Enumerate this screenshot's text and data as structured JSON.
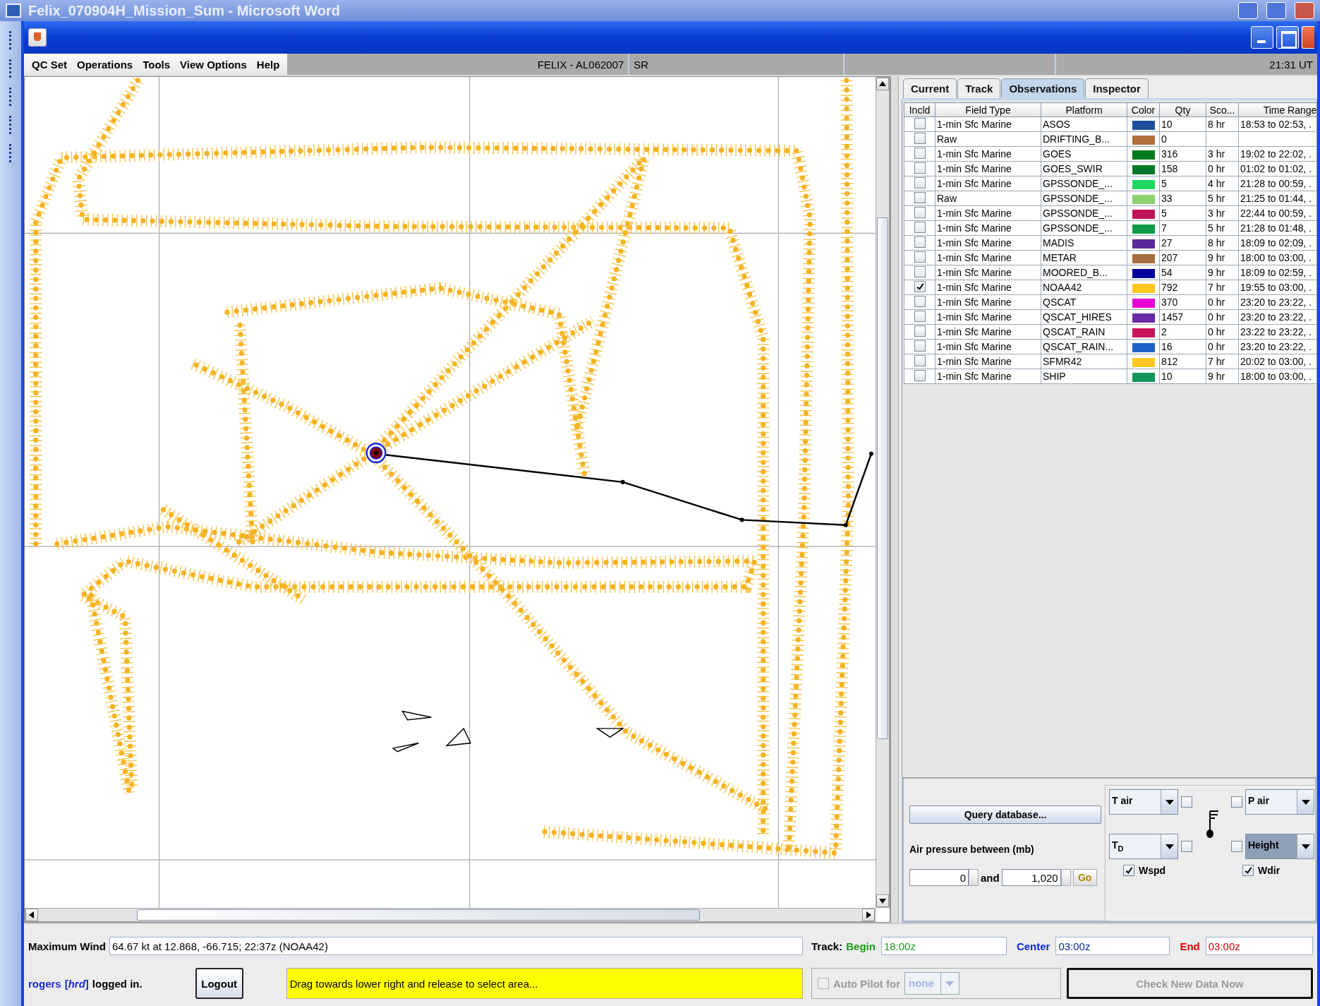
{
  "background_window": {
    "title": "Felix_070904H_Mission_Sum - Microsoft Word"
  },
  "window": {
    "menu": [
      "QC Set",
      "Operations",
      "Tools",
      "View Options",
      "Help"
    ],
    "storm": "FELIX - AL062007",
    "mode": "SR",
    "clock": "21:31 UT"
  },
  "tabs": [
    {
      "label": "Current",
      "selected": false
    },
    {
      "label": "Track",
      "selected": false
    },
    {
      "label": "Observations",
      "selected": true
    },
    {
      "label": "Inspector",
      "selected": false
    }
  ],
  "table": {
    "columns": [
      "Incld",
      "Field Type",
      "Platform",
      "Color",
      "Qty",
      "Sco...",
      "Time Range"
    ],
    "rows": [
      {
        "included": false,
        "field_type": "1-min Sfc Marine",
        "platform": "ASOS",
        "color": "#1f4f9a",
        "qty": "10",
        "scope": "8 hr",
        "time_range": "18:53 to 02:53, ."
      },
      {
        "included": false,
        "field_type": "Raw",
        "platform": "DRIFTING_B...",
        "color": "#b06e3a",
        "qty": "0"
      },
      {
        "included": false,
        "field_type": "1-min Sfc Marine",
        "platform": "GOES",
        "color": "#007a1e",
        "qty": "316",
        "scope": "3 hr",
        "time_range": "19:02 to 22:02, ."
      },
      {
        "included": false,
        "field_type": "1-min Sfc Marine",
        "platform": "GOES_SWIR",
        "color": "#007828",
        "qty": "158",
        "scope": "0 hr",
        "time_range": "01:02 to 01:02, ."
      },
      {
        "included": false,
        "field_type": "1-min Sfc Marine",
        "platform": "GPSSONDE_...",
        "color": "#1ed760",
        "qty": "5",
        "scope": "4 hr",
        "time_range": "21:28 to 00:59, ."
      },
      {
        "included": false,
        "field_type": "Raw",
        "platform": "GPSSONDE_...",
        "color": "#8fd070",
        "qty": "33",
        "scope": "5 hr",
        "time_range": "21:25 to 01:44, ."
      },
      {
        "included": false,
        "field_type": "1-min Sfc Marine",
        "platform": "GPSSONDE_...",
        "color": "#c0145a",
        "qty": "5",
        "scope": "3 hr",
        "time_range": "22:44 to 00:59, ."
      },
      {
        "included": false,
        "field_type": "1-min Sfc Marine",
        "platform": "GPSSONDE_...",
        "color": "#0e9a48",
        "qty": "7",
        "scope": "5 hr",
        "time_range": "21:28 to 01:48, ."
      },
      {
        "included": false,
        "field_type": "1-min Sfc Marine",
        "platform": "MADIS",
        "color": "#5b2a96",
        "qty": "27",
        "scope": "8 hr",
        "time_range": "18:09 to 02:09, ."
      },
      {
        "included": false,
        "field_type": "1-min Sfc Marine",
        "platform": "METAR",
        "color": "#a86d3e",
        "qty": "207",
        "scope": "9 hr",
        "time_range": "18:00 to 03:00, ."
      },
      {
        "included": false,
        "field_type": "1-min Sfc Marine",
        "platform": "MOORED_B...",
        "color": "#000099",
        "qty": "54",
        "scope": "9 hr",
        "time_range": "18:09 to 02:59, ."
      },
      {
        "included": true,
        "field_type": "1-min Sfc Marine",
        "platform": "NOAA42",
        "color": "#ffc61e",
        "qty": "792",
        "scope": "7 hr",
        "time_range": "19:55 to 03:00, ."
      },
      {
        "included": false,
        "field_type": "1-min Sfc Marine",
        "platform": "QSCAT",
        "color": "#e600d4",
        "qty": "370",
        "scope": "0 hr",
        "time_range": "23:20 to 23:22, ."
      },
      {
        "included": false,
        "field_type": "1-min Sfc Marine",
        "platform": "QSCAT_HIRES",
        "color": "#6a2aa6",
        "qty": "1457",
        "scope": "0 hr",
        "time_range": "23:20 to 23:22, ."
      },
      {
        "included": false,
        "field_type": "1-min Sfc Marine",
        "platform": "QSCAT_RAIN",
        "color": "#c8145a",
        "qty": "2",
        "scope": "0 hr",
        "time_range": "23:22 to 23:22, ."
      },
      {
        "included": false,
        "field_type": "1-min Sfc Marine",
        "platform": "QSCAT_RAIN...",
        "color": "#1e62c8",
        "qty": "16",
        "scope": "0 hr",
        "time_range": "23:20 to 23:22, ."
      },
      {
        "included": false,
        "field_type": "1-min Sfc Marine",
        "platform": "SFMR42",
        "color": "#ffc820",
        "qty": "812",
        "scope": "7 hr",
        "time_range": "20:02 to 03:00, ."
      },
      {
        "included": false,
        "field_type": "1-min Sfc Marine",
        "platform": "SHIP",
        "color": "#12955a",
        "qty": "10",
        "scope": "9 hr",
        "time_range": "18:00 to 03:00, ."
      }
    ]
  },
  "query": {
    "button": "Query database...",
    "pressure_label": "Air pressure between (mb)",
    "min": "0",
    "and": "and",
    "max": "1,020",
    "go": "Go"
  },
  "station_model": {
    "combos": [
      {
        "value": "T air",
        "checked": false,
        "highlighted": false
      },
      {
        "value": "P air",
        "checked": false,
        "highlighted": false
      },
      {
        "value": "T$_{D}$",
        "checked": false,
        "highlighted": false
      },
      {
        "value": "Height",
        "checked": false,
        "highlighted": true
      }
    ],
    "wind_checks": [
      {
        "label": "Wspd",
        "checked": true
      },
      {
        "label": "Wdir",
        "checked": true
      }
    ]
  },
  "status": {
    "max_wind_label": "Maximum Wind",
    "max_wind_value": "64.67 kt at 12.868,  -66.715; 22:37z (NOAA42)",
    "user": "rogers",
    "group": "[*hrd*]",
    "login_text": "logged in.",
    "logout": "Logout",
    "hint": "Drag towards lower right and release to select area...",
    "track": {
      "label": "Track:",
      "begin_label": "Begin",
      "begin": "18:00z",
      "center_label": "Center",
      "center": "03:00z",
      "end_label": "End",
      "end": "03:00z"
    },
    "autopilot": {
      "label": "Auto Pilot for",
      "checked": false,
      "value": "none",
      "disabled": true
    },
    "check_button": {
      "label": "Check New Data Now",
      "disabled": true
    }
  }
}
